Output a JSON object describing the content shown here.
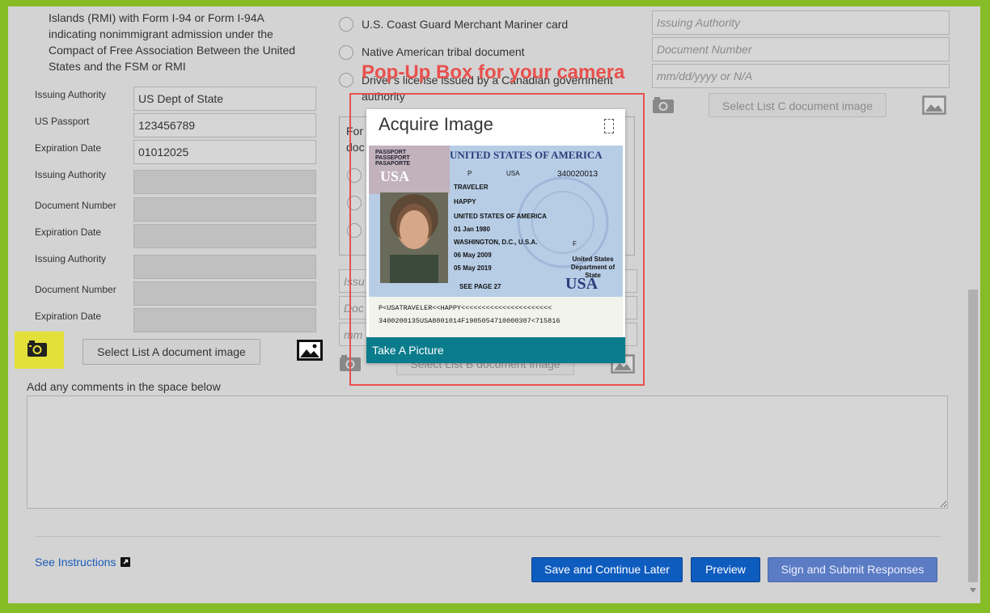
{
  "list_a": {
    "description_lines": [
      "Islands (RMI) with Form I-94 or Form I-94A",
      "indicating nonimmigrant admission under the",
      "Compact of Free Association Between the United",
      "States and the FSM or RMI"
    ],
    "doc1": {
      "issuing_authority_label": "Issuing Authority",
      "issuing_authority_value": "US Dept of State",
      "document_label": "US Passport",
      "document_value": "123456789",
      "expiration_label": "Expiration Date",
      "expiration_value": "01012025"
    },
    "doc2": {
      "issuing_authority_label": "Issuing Authority",
      "document_label": "Document Number",
      "expiration_label": "Expiration Date"
    },
    "doc3": {
      "issuing_authority_label": "Issuing Authority",
      "document_label": "Document Number",
      "expiration_label": "Expiration Date"
    },
    "select_image_button": "Select List A document image"
  },
  "list_b": {
    "options": [
      "U.S. Coast Guard Merchant Mariner card",
      "Native American tribal document",
      "Driver's license issued by a Canadian government",
      "authority"
    ],
    "box_partial_lines": [
      "For",
      "doc"
    ],
    "field_partials": [
      "Issu",
      "Doc",
      "mm"
    ],
    "select_image_button": "Select List B document image"
  },
  "list_c": {
    "issuing_authority_placeholder": "Issuing Authority",
    "document_number_placeholder": "Document Number",
    "expiration_placeholder": "mm/dd/yyyy or N/A",
    "select_image_button": "Select List C document image"
  },
  "annotation": "Pop-Up Box for your camera",
  "popup": {
    "title": "Acquire Image",
    "take_picture": "Take A Picture",
    "passport": {
      "header_left": [
        "PASSPORT",
        "PASSEPORT",
        "PASAPORTE"
      ],
      "country": "UNITED STATES OF AMERICA",
      "type": "P",
      "code": "USA",
      "passport_no": "340020013",
      "surname": "TRAVELER",
      "given_names": "HAPPY",
      "nationality": "UNITED STATES OF AMERICA",
      "dob": "01 Jan 1980",
      "pob": "WASHINGTON, D.C., U.S.A.",
      "sex": "F",
      "issue_date": "06 May 2009",
      "authority": "United States",
      "authority2": "Department of State",
      "exp_date": "05 May 2019",
      "see_page": "SEE PAGE 27",
      "usa_mark": "USA",
      "mrz1": "P<USATRAVELER<<HAPPY<<<<<<<<<<<<<<<<<<<<<<",
      "mrz2": "3400200135USA8001014F1905054710000307<715816"
    }
  },
  "comments_label": "Add any comments in the space below",
  "footer": {
    "see_instructions": "See Instructions",
    "save_later": "Save and Continue Later",
    "preview": "Preview",
    "sign_submit": "Sign and Submit Responses"
  },
  "colors": {
    "border_green": "#86bc25",
    "highlight_yellow": "#e4e03a",
    "annotation_red": "#e8504d",
    "button_blue": "#0f5cbf",
    "teal_bar": "#0a7c8c"
  }
}
